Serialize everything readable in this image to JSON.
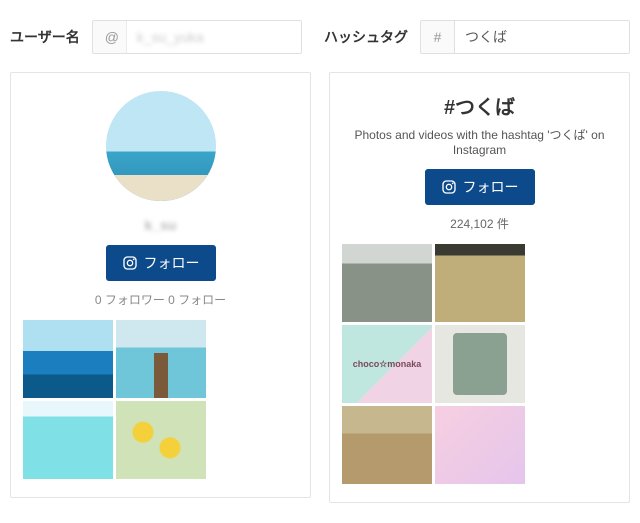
{
  "left": {
    "label": "ユーザー名",
    "prefix": "@",
    "input_value": "k_su_yuka",
    "username_display": "k_su",
    "follow_label": "フォロー",
    "stats": "0 フォロワー 0 フォロー"
  },
  "right": {
    "label": "ハッシュタグ",
    "prefix": "#",
    "input_value": "つくば",
    "title": "#つくば",
    "subtitle": "Photos and videos with the hashtag 'つくば' on Instagram",
    "follow_label": "フォロー",
    "count": "224,102 件",
    "pastel_text": "choco☆monaka"
  }
}
